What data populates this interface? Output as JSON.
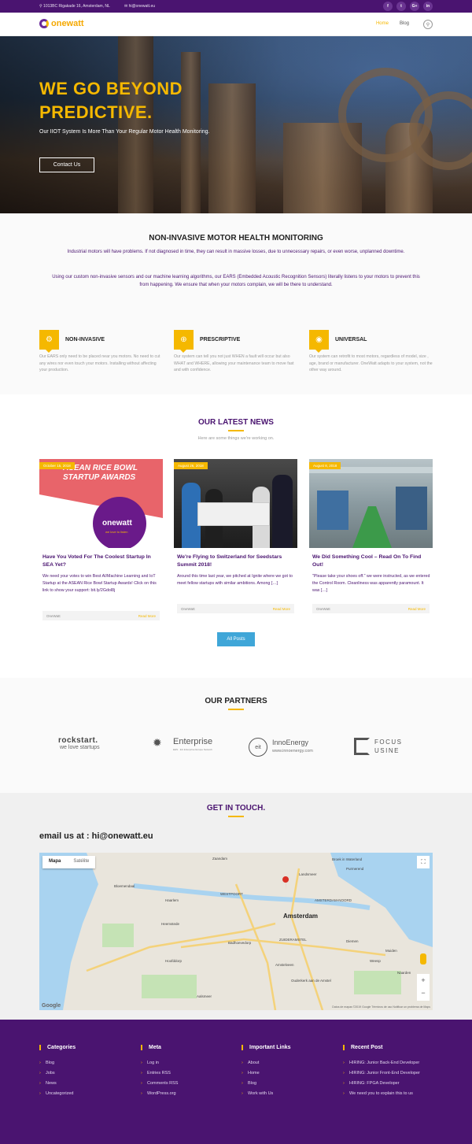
{
  "topbar": {
    "address": "⚲ 1013BC Rigakade 16, Amsterdam, NL",
    "email": "✉ hi@onewatt.eu",
    "socials": [
      "f",
      "t",
      "G+",
      "in"
    ]
  },
  "nav": {
    "logo": "onewatt",
    "links": [
      "Home",
      "Blog"
    ]
  },
  "hero": {
    "title": "WE GO BEYOND PREDICTIVE.",
    "subtitle": "Our IIOT System Is More Than Your Regular Motor Health Monitoring.",
    "cta": "Contact Us"
  },
  "intro": {
    "title": "NON-INVASIVE MOTOR HEALTH MONITORING",
    "p1": "Industrial motors will have problems. If not diagnosed in time, they can result in massive losses, due to unnecessary repairs, or even worse, unplanned downtime.",
    "p2": "Using our custom non-invasive sensors and our machine learning algorithms, our EARS (Embedded Acoustic Recognition Sensors) literally listens to your motors to prevent this from happening. We ensure that when your motors complain, we will be there to understand."
  },
  "features": [
    {
      "icon": "gear-icon",
      "title": "NON-INVASIVE",
      "desc": "Our EARS only need to be placed near you motors. No need to cut any wires nor even touch your motors. Installing without affecting your production."
    },
    {
      "icon": "target-icon",
      "title": "PRESCRIPTIVE",
      "desc": "Our system can tell you not just WHEN a fault will occur but also WHAT and WHERE, allowing your maintenance team to move fast and with confidence."
    },
    {
      "icon": "globe-icon",
      "title": "UNIVERSAL",
      "desc": "Our system can retrofit to most motors, regardless of model, size , age, brand or manufacturer. OneWatt adapts to your system, not the other way around."
    }
  ],
  "news": {
    "title": "OUR LATEST NEWS",
    "subtitle": "Here are some things we're working on.",
    "posts": [
      {
        "date": "October 15, 2018",
        "title": "Have You Voted For The Coolest Startup In SEA Yet?",
        "excerpt": "We need your votes to win Best AI/Machine Learning and IoT Startup at the ASEAN Rice Bowl Startup Awards! Click on this link to show your support: bit.ly/2Gdol8j",
        "author": "OneWatt",
        "more": "Read More",
        "img_text": "ASEAN RICE BOWL STARTUP AWARDS",
        "img_logo": "onewatt",
        "img_tag": "we love to listen"
      },
      {
        "date": "August 26, 2018",
        "title": "We're Flying to Switzerland for Seedstars Summit 2018!",
        "excerpt": "Around this time last year, we pitched at Ignite where we got to meet fellow startups with similar ambitions. Among […]",
        "author": "OneWatt",
        "more": "Read More"
      },
      {
        "date": "August 8, 2018",
        "title": "We Did Something Cool – Read On To Find Out!",
        "excerpt": "\"Please take your shoes off.\" we were instructed, as we entered the Control Room. Cleanliness was apparently paramount. It was […]",
        "author": "OneWatt",
        "more": "Read More"
      }
    ],
    "all_posts": "All Posts"
  },
  "partners": {
    "title": "OUR PARTNERS",
    "logos": [
      {
        "name": "rockstart.",
        "tag": "we love startups"
      },
      {
        "name": "Enterprise",
        "tag": "EEN · EU Enterprise Europe Network"
      },
      {
        "name": "InnoEnergy",
        "tag": "www.innoenergy.com",
        "badge": "eit"
      },
      {
        "name": "FOCUS USINE"
      }
    ]
  },
  "contact": {
    "title": "GET IN TOUCH.",
    "email_line": "email us at : hi@onewatt.eu",
    "map": {
      "tabs": [
        "Mapa",
        "Satélite"
      ],
      "city": "Amsterdam",
      "labels": [
        "Haarlem",
        "Zaandam",
        "Amstelveen",
        "Hoofddorp",
        "Diemen",
        "Purmerend",
        "AMSTERDAM-NOORD",
        "WESTPOORT",
        "ZUIDERAMSTEL",
        "Badhoevedorp",
        "Heemstede",
        "Bloemendaal",
        "Aalsmeer",
        "Ouderkerk aan de Amstel",
        "Weesp",
        "Naarden",
        "Muiden",
        "Landsmeer",
        "Broek in Waterland"
      ],
      "attribution": "Datos de mapas ©2019 Google   Términos de uso   Notificar un problema de Maps",
      "google": "Google"
    }
  },
  "footer": {
    "columns": [
      {
        "title": "Categories",
        "items": [
          "Blog",
          "Jobs",
          "News",
          "Uncategorized"
        ]
      },
      {
        "title": "Meta",
        "items": [
          "Log in",
          "Entries RSS",
          "Comments RSS",
          "WordPress.org"
        ]
      },
      {
        "title": "Important Links",
        "items": [
          "About",
          "Home",
          "Blog",
          "Work with Us"
        ]
      },
      {
        "title": "Recent Post",
        "items": [
          "HIRING: Junior Back-End Developer",
          "HIRING: Junior Front-End Developer",
          "HIRING: FPGA Developer",
          "We need you to explain this to us"
        ]
      }
    ]
  },
  "colors": {
    "brand_purple": "#4a1470",
    "accent_yellow": "#f5b800",
    "button_blue": "#3fa6d8"
  }
}
